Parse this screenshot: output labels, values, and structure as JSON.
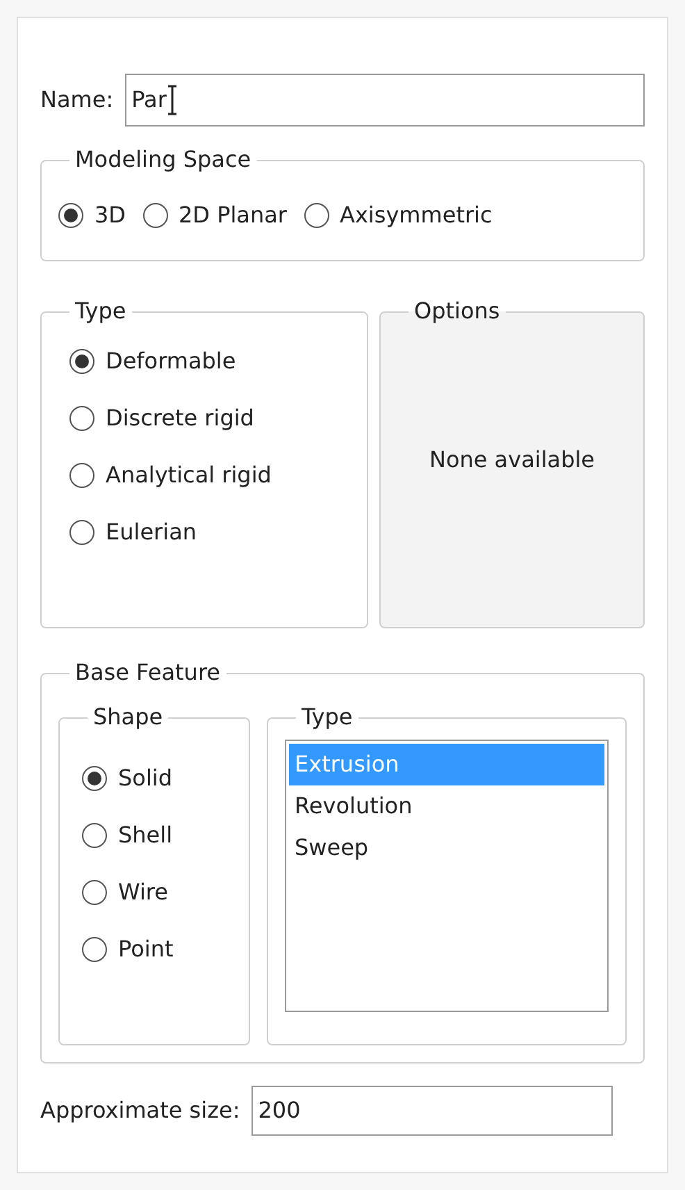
{
  "name": {
    "label": "Name:",
    "value": "Par"
  },
  "modeling_space": {
    "title": "Modeling Space",
    "options": [
      {
        "label": "3D",
        "selected": true
      },
      {
        "label": "2D Planar",
        "selected": false
      },
      {
        "label": "Axisymmetric",
        "selected": false
      }
    ]
  },
  "type": {
    "title": "Type",
    "options": [
      {
        "label": "Deformable",
        "selected": true
      },
      {
        "label": "Discrete rigid",
        "selected": false
      },
      {
        "label": "Analytical rigid",
        "selected": false
      },
      {
        "label": "Eulerian",
        "selected": false
      }
    ]
  },
  "options": {
    "title": "Options",
    "text": "None available"
  },
  "base_feature": {
    "title": "Base Feature",
    "shape": {
      "title": "Shape",
      "options": [
        {
          "label": "Solid",
          "selected": true
        },
        {
          "label": "Shell",
          "selected": false
        },
        {
          "label": "Wire",
          "selected": false
        },
        {
          "label": "Point",
          "selected": false
        }
      ]
    },
    "type": {
      "title": "Type",
      "items": [
        {
          "label": "Extrusion",
          "selected": true
        },
        {
          "label": "Revolution",
          "selected": false
        },
        {
          "label": "Sweep",
          "selected": false
        }
      ]
    }
  },
  "approximate_size": {
    "label": "Approximate size:",
    "value": "200"
  }
}
